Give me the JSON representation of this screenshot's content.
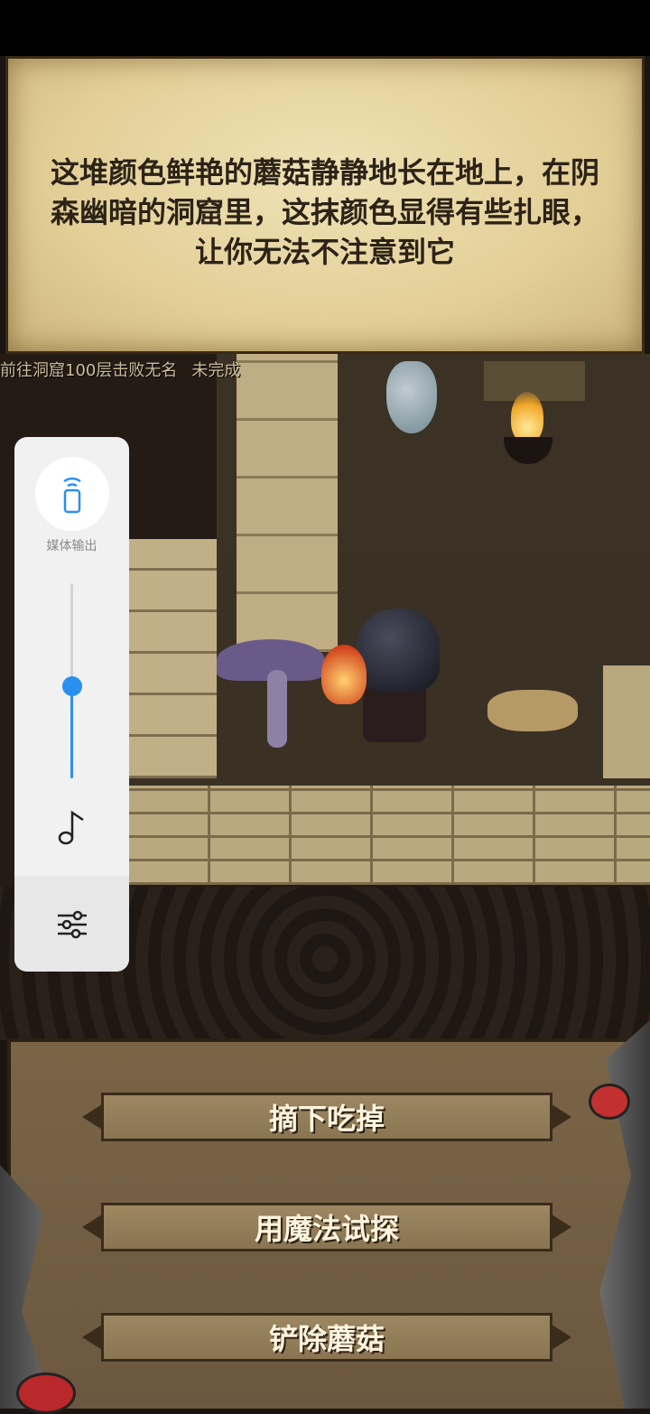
{
  "dialog": {
    "text": "这堆颜色鲜艳的蘑菇静静地长在地上，在阴森幽暗的洞窟里，这抹颜色显得有些扎眼，让你无法不注意到它"
  },
  "quest": {
    "title": "前往洞窟100层击败无名",
    "status": "未完成"
  },
  "media_panel": {
    "output_label": "媒体输出",
    "output_icon": "phone-speaker-icon",
    "volume_fraction": 0.47,
    "music_icon": "music-note-icon",
    "settings_icon": "equalizer-icon",
    "accent": "#2b8ff0"
  },
  "choices": [
    {
      "label": "摘下吃掉"
    },
    {
      "label": "用魔法试探"
    },
    {
      "label": "铲除蘑菇"
    }
  ]
}
